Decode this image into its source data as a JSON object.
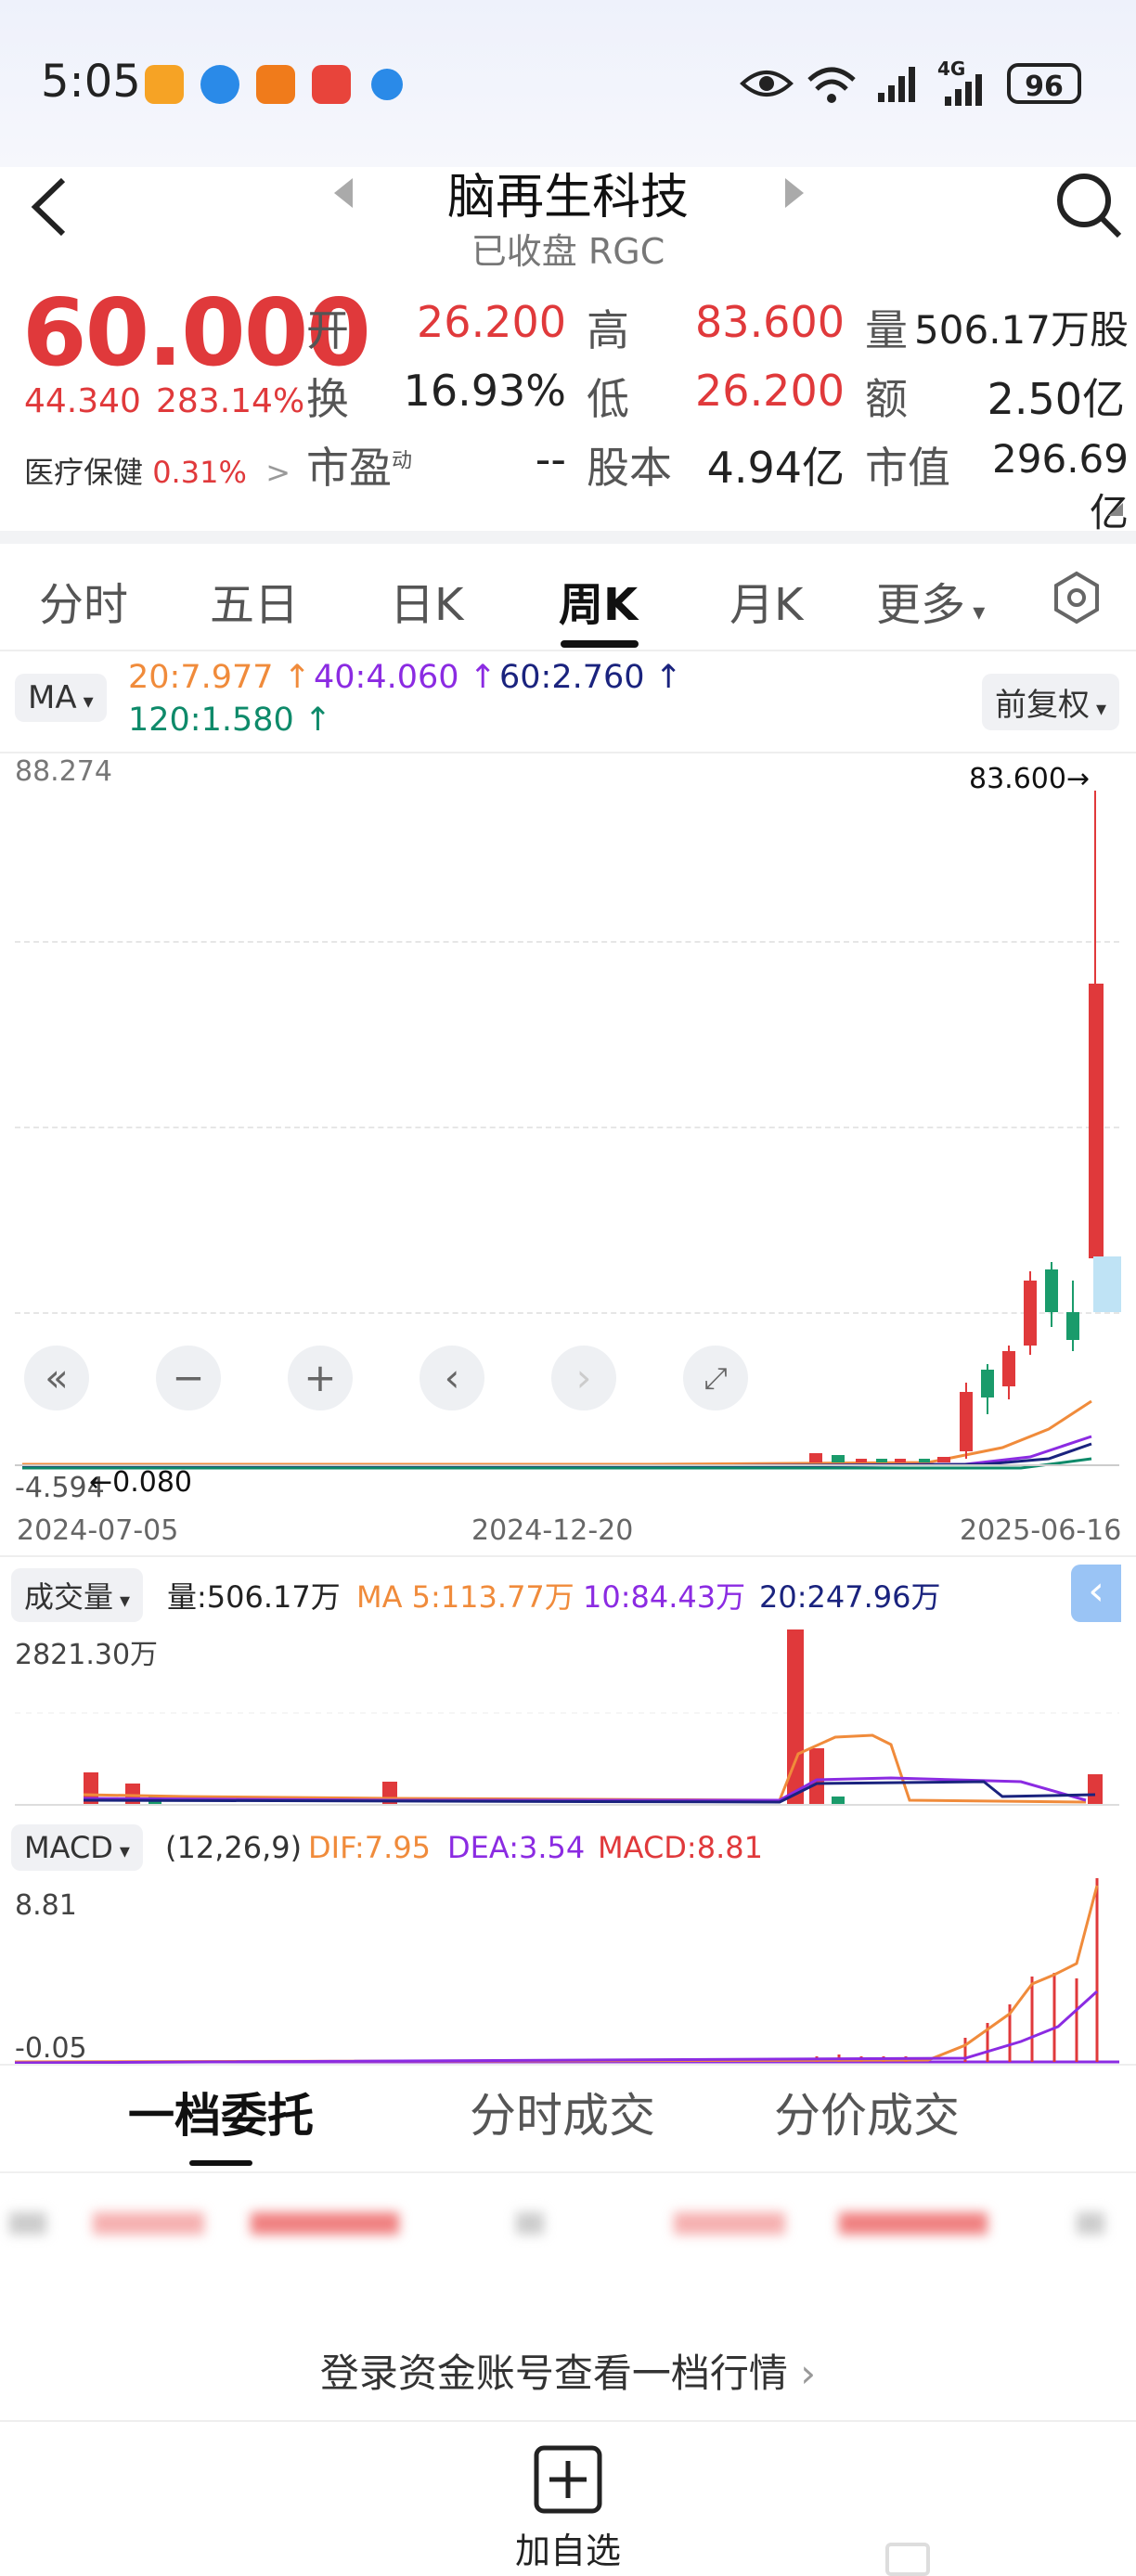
{
  "status_bar": {
    "time": "5:05",
    "battery": "96",
    "signal_label": "4G"
  },
  "header": {
    "title": "脑再生科技",
    "subtitle": "已收盘 RGC"
  },
  "quote": {
    "price": "60.000",
    "change": "44.340",
    "change_pct": "283.14%",
    "sector": "医疗保健",
    "sector_pct": "0.31%",
    "fields": {
      "open_label": "开",
      "open": "26.200",
      "high_label": "高",
      "high": "83.600",
      "volume_label": "量",
      "volume": "506.17万股",
      "turnover_label": "换",
      "turnover": "16.93%",
      "low_label": "低",
      "low": "26.200",
      "amount_label": "额",
      "amount": "2.50亿",
      "pe_label": "市盈",
      "pe_sup": "动",
      "pe": "--",
      "shares_label": "股本",
      "shares": "4.94亿",
      "mktcap_label": "市值",
      "mktcap": "296.69亿"
    }
  },
  "tabs": [
    "分时",
    "五日",
    "日K",
    "周K",
    "月K",
    "更多"
  ],
  "active_tab": "周K",
  "main_chart": {
    "ma_selector": "MA",
    "ma20": "20:7.977 ↑",
    "ma40": "40:4.060 ↑",
    "ma60": "60:2.760 ↑",
    "ma120": "120:1.580 ↑",
    "adjust_selector": "前复权",
    "y_top": "88.274",
    "y_bottom": "-4.594",
    "max_marker": "83.600→",
    "min_marker": "←0.080",
    "x_labels": [
      "2024-07-05",
      "2024-12-20",
      "2025-06-16"
    ]
  },
  "volume_chart": {
    "selector": "成交量",
    "vol": "量:506.17万",
    "ma5": "MA 5:113.77万",
    "ma10": "10:84.43万",
    "ma20": "20:247.96万",
    "y_top": "2821.30万"
  },
  "macd_chart": {
    "selector": "MACD",
    "params": "(12,26,9)",
    "dif": "DIF:7.95",
    "dea": "DEA:3.54",
    "macd": "MACD:8.81",
    "y_top": "8.81",
    "y_bottom": "-0.05"
  },
  "bottom_tabs": [
    "一档委托",
    "分时成交",
    "分价成交"
  ],
  "login_prompt": "登录资金账号查看一档行情",
  "add_watchlist": "加自选",
  "colors": {
    "up": "#e0393b",
    "down": "#1a9b6b",
    "ma20": "#f08b3b",
    "ma40": "#8b2be2",
    "ma60": "#1a237e",
    "ma120": "#0e8a6a"
  }
}
